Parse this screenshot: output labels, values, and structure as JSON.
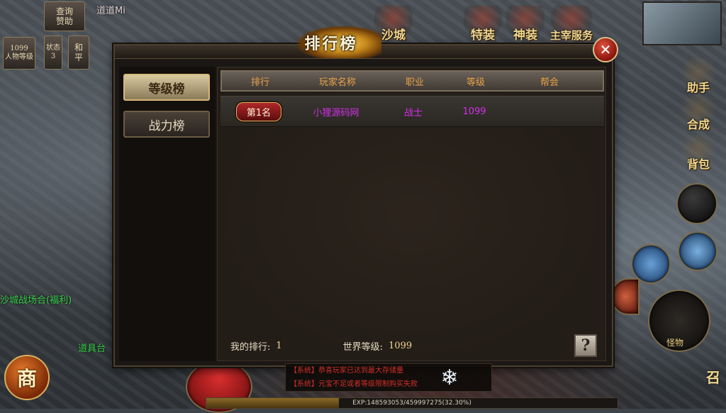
{
  "hud": {
    "top_left_buttons": [
      {
        "label": "查询\n赞助"
      },
      {
        "label": "1099\n人物等级"
      },
      {
        "label": "状态\n3"
      },
      {
        "label": "和\n平"
      }
    ],
    "player_name": "道道Mi",
    "top_buttons": [
      "沙城",
      "特装",
      "神装",
      "主宰服务"
    ],
    "side_buttons": [
      "助手",
      "合成",
      "背包"
    ],
    "left_chat_green": [
      "沙城战场合(福利)",
      "道具台"
    ],
    "bottom_left_label": "商",
    "right_skill_label": "怪物",
    "right_bottom_label": "召"
  },
  "panel": {
    "title": "排行榜",
    "close_label": "✕",
    "tabs": [
      {
        "label": "等级榜",
        "active": true
      },
      {
        "label": "战力榜",
        "active": false
      }
    ],
    "columns": [
      "排行",
      "玩家名称",
      "职业",
      "等级",
      "帮会"
    ],
    "rows": [
      {
        "rank": "第1名",
        "name": "小狸源码网",
        "class": "战士",
        "level": "1099",
        "guild": ""
      }
    ],
    "footer": {
      "my_rank_label": "我的排行:",
      "my_rank_value": "1",
      "world_level_label": "世界等级:",
      "world_level_value": "1099",
      "help_label": "?"
    },
    "colors": {
      "header_text": "#e8a14a",
      "row_text": "#d030e8",
      "rank_badge": "#b0282a"
    }
  },
  "chat": {
    "lines": [
      "【系统】恭喜玩家已达到最大存储量",
      "【系统】元宝不足或者等级限制购买失败"
    ]
  },
  "exp": {
    "text": "EXP:148593053/459997275(32.30%)",
    "fraction": 0.323
  }
}
